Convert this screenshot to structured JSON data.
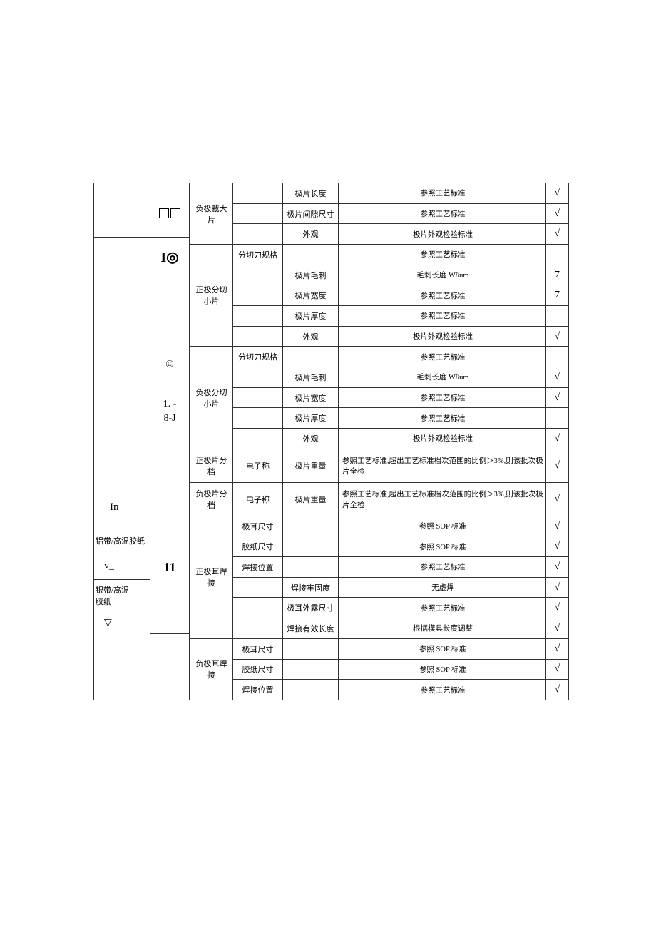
{
  "left": {
    "s2_in": "In",
    "s2_mat": "铝带/高温胶纸",
    "s2_v": "v_",
    "s3_mat": "银带/高温\n胶纸",
    "s3_sym": "▽"
  },
  "sym": {
    "r1": "I◎",
    "r2": "©",
    "r3a": "1. -",
    "r3b": "8-J",
    "r4": "11"
  },
  "rows": [
    {
      "proc": "负极裁大片",
      "col4": "",
      "col5": "极片长度",
      "col6": "参照工艺标准",
      "col6c": true,
      "col7": "√",
      "rs": 3
    },
    {
      "col4": "",
      "col5": "极片间隙尺寸",
      "col6": "参照工艺标准",
      "col6c": true,
      "col7": "√"
    },
    {
      "col4": "",
      "col5": "外观",
      "col6": "极片外观检验标准",
      "col6c": true,
      "col7": "√"
    },
    {
      "proc": "正极分切\n小片",
      "col4": "分切刀规格",
      "col5": "",
      "col6": "参照工艺标准",
      "col6c": true,
      "col7": "",
      "rs": 5
    },
    {
      "col4": "",
      "col5": "极片毛刺",
      "col6": "毛刺长度 W8um",
      "col6c": true,
      "col7": "7"
    },
    {
      "col4": "",
      "col5": "极片宽度",
      "col6": "参照工艺标准",
      "col6c": true,
      "col7": "7"
    },
    {
      "col4": "",
      "col5": "极片厚度",
      "col6": "参照工艺标准",
      "col6c": true,
      "col7": ""
    },
    {
      "col4": "",
      "col5": "外观",
      "col6": "极片外观检验标准",
      "col6c": true,
      "col7": "√"
    },
    {
      "proc": "负极分切\n小片",
      "col4": "分切刀规格",
      "col5": "",
      "col6": "参照工艺标准",
      "col6c": true,
      "col7": "",
      "rs": 5
    },
    {
      "col4": "",
      "col5": "极片毛刺",
      "col6": "毛刺长度 W8um",
      "col6c": true,
      "col7": "√"
    },
    {
      "col4": "",
      "col5": "极片宽度",
      "col6": "参照工艺标准",
      "col6c": true,
      "col7": "√"
    },
    {
      "col4": "",
      "col5": "极片厚度",
      "col6": "参照工艺标准",
      "col6c": true,
      "col7": ""
    },
    {
      "col4": "",
      "col5": "外观",
      "col6": "极片外观检验标准",
      "col6c": true,
      "col7": "√"
    },
    {
      "proc": "正极片分档",
      "col4": "电子称",
      "col5": "极片重量",
      "col6": "参照工艺标准,超出工艺标准档次范围的比例＞3%,则该批次极片全检",
      "col6c": false,
      "col7": "√",
      "rs": 1
    },
    {
      "proc": "负极片分档",
      "col4": "电子称",
      "col5": "极片重量",
      "col6": "参照工艺标准,超出工艺标准档次范围的比例＞3%,则该批次极片全检",
      "col6c": false,
      "col7": "√",
      "rs": 1
    },
    {
      "proc": "正极耳焊接",
      "col4": "极耳尺寸",
      "col5": "",
      "col6": "参照 SOP 标准",
      "col6c": true,
      "col7": "√",
      "rs": 6
    },
    {
      "col4": "胶纸尺寸",
      "col5": "",
      "col6": "参照 SOP 标准",
      "col6c": true,
      "col7": "√"
    },
    {
      "col4": "焊接位置",
      "col5": "",
      "col6": "参照工艺标准",
      "col6c": true,
      "col7": "√"
    },
    {
      "col4": "",
      "col5": "焊接牢固度",
      "col6": "无虚焊",
      "col6c": true,
      "col7": "√"
    },
    {
      "col4": "",
      "col5": "极耳外露尺寸",
      "col6": "参照工艺标准",
      "col6c": true,
      "col7": "√"
    },
    {
      "col4": "",
      "col5": "焊接有效长度",
      "col6": "根据模具长度调整",
      "col6c": true,
      "col7": "√"
    },
    {
      "proc": "负极耳焊接",
      "col4": "极耳尺寸",
      "col5": "",
      "col6": "参照 SOP 标准",
      "col6c": true,
      "col7": "√",
      "rs": 3
    },
    {
      "col4": "胶纸尺寸",
      "col5": "",
      "col6": "参照 SOP 标准",
      "col6c": true,
      "col7": "√"
    },
    {
      "col4": "焊接位置",
      "col5": "",
      "col6": "参照工艺标准",
      "col6c": true,
      "col7": "√"
    }
  ]
}
